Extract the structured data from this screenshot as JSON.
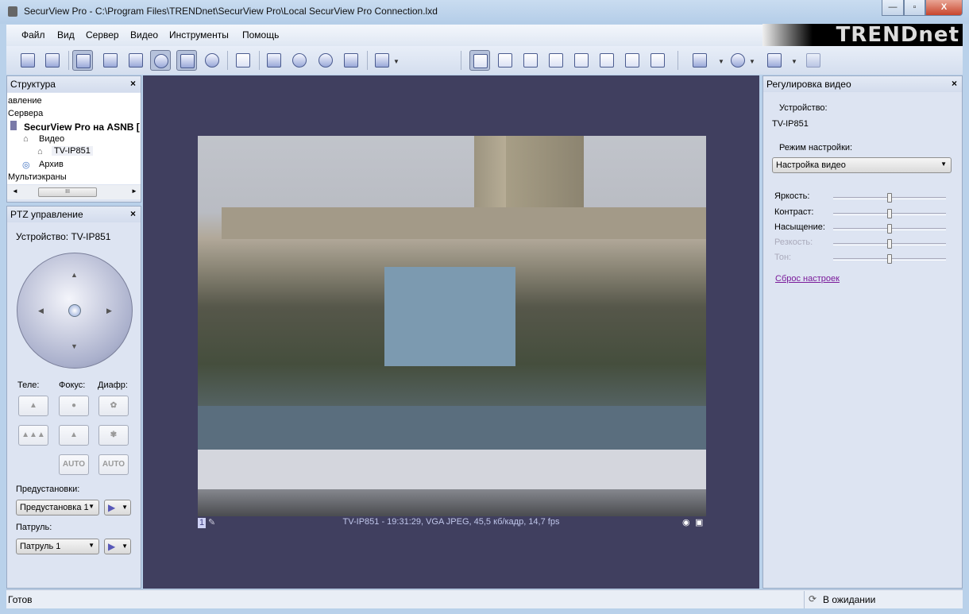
{
  "window": {
    "title": "SecurView Pro - C:\\Program Files\\TRENDnet\\SecurView Pro\\Local SecurView Pro Connection.lxd",
    "minimize": "—",
    "maximize": "▫",
    "close": "X"
  },
  "menu": [
    "Файл",
    "Вид",
    "Сервер",
    "Видео",
    "Инструменты",
    "Помощь"
  ],
  "logo": "TRENDnet",
  "structure": {
    "title": "Структура",
    "items": [
      "авление",
      "Сервера",
      "SecurView Pro на ASNB [",
      "Видео",
      "TV-IP851",
      "Архив",
      "Мультиэкраны"
    ],
    "scroll_thumb": "III"
  },
  "ptz": {
    "title": "PTZ управление",
    "device": "Устройство: TV-IP851",
    "tele": "Теле:",
    "focus": "Фокус:",
    "iris": "Диафр:",
    "auto": "AUTO",
    "presets_label": "Предустановки:",
    "preset_value": "Предустановка 1",
    "patrol_label": "Патруль:",
    "patrol_value": "Патруль 1"
  },
  "video": {
    "channel": "1",
    "status": "TV-IP851 - 19:31:29, VGA JPEG, 45,5 кб/кадр, 14,7 fps"
  },
  "adjust": {
    "title": "Регулировка видео",
    "device_label": "Устройство:",
    "device": "TV-IP851",
    "mode_label": "Режим настройки:",
    "mode_value": "Настройка видео",
    "sliders": [
      {
        "label": "Яркость:",
        "value": 50,
        "enabled": true
      },
      {
        "label": "Контраст:",
        "value": 50,
        "enabled": true
      },
      {
        "label": "Насыщение:",
        "value": 50,
        "enabled": true
      },
      {
        "label": "Резкость:",
        "value": 50,
        "enabled": false
      },
      {
        "label": "Тон:",
        "value": 50,
        "enabled": false
      }
    ],
    "reset": "Сброс настроек"
  },
  "status": {
    "left": "Готов",
    "right": "В ожидании"
  },
  "close_glyph": "×"
}
